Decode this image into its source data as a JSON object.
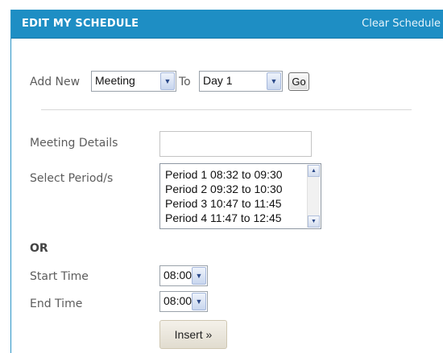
{
  "header": {
    "title": "EDIT MY SCHEDULE",
    "clear_link": "Clear Schedule"
  },
  "add_row": {
    "label_add_new": "Add New",
    "type_value": "Meeting",
    "label_to": "To",
    "day_value": "Day 1",
    "go_label": "Go"
  },
  "form": {
    "meeting_details_label": "Meeting Details",
    "meeting_details_value": "",
    "select_periods_label": "Select Period/s",
    "periods": [
      "Period 1 08:32 to 09:30",
      "Period 2 09:32 to 10:30",
      "Period 3 10:47 to 11:45",
      "Period 4 11:47 to 12:45"
    ],
    "or_label": "OR",
    "start_time_label": "Start Time",
    "start_time_value": "08:00",
    "end_time_label": "End Time",
    "end_time_value": "08:00",
    "insert_label": "Insert »"
  },
  "icons": {
    "dropdown": "chevron-down-icon",
    "scroll_up": "scroll-up-icon",
    "scroll_down": "scroll-down-icon"
  },
  "colors": {
    "header_bg": "#1e8ec4",
    "header_text": "#ffffff"
  }
}
